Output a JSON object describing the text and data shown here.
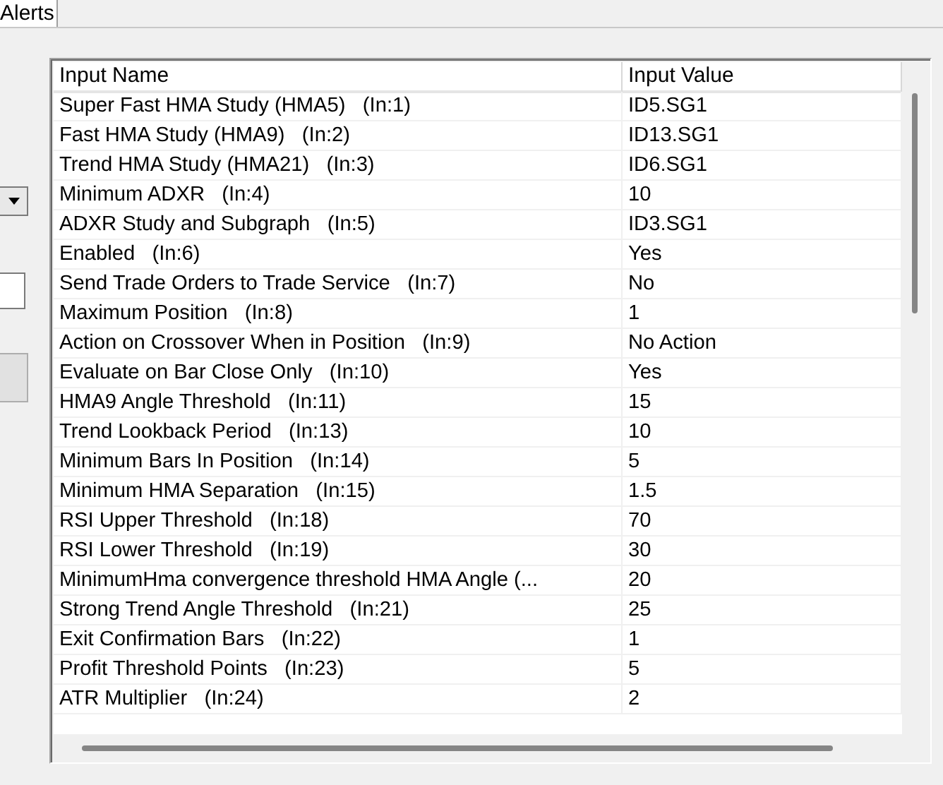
{
  "tabs": [
    {
      "label": "Alerts",
      "selected": true
    }
  ],
  "table": {
    "columns": [
      "Input Name",
      "Input Value"
    ],
    "rows": [
      {
        "name": "Super Fast HMA Study (HMA5)   (In:1)",
        "value": "ID5.SG1"
      },
      {
        "name": "Fast HMA Study (HMA9)   (In:2)",
        "value": "ID13.SG1"
      },
      {
        "name": "Trend HMA Study (HMA21)   (In:3)",
        "value": "ID6.SG1"
      },
      {
        "name": "Minimum ADXR   (In:4)",
        "value": "10"
      },
      {
        "name": "ADXR Study and Subgraph   (In:5)",
        "value": "ID3.SG1"
      },
      {
        "name": "Enabled   (In:6)",
        "value": "Yes"
      },
      {
        "name": "Send Trade Orders to Trade Service   (In:7)",
        "value": "No"
      },
      {
        "name": "Maximum Position   (In:8)",
        "value": "1"
      },
      {
        "name": "Action on Crossover When in Position   (In:9)",
        "value": "No Action"
      },
      {
        "name": "Evaluate on Bar Close Only   (In:10)",
        "value": "Yes"
      },
      {
        "name": "HMA9 Angle Threshold   (In:11)",
        "value": "15"
      },
      {
        "name": "Trend Lookback Period   (In:13)",
        "value": "10"
      },
      {
        "name": "Minimum Bars In Position   (In:14)",
        "value": "5"
      },
      {
        "name": "Minimum HMA Separation   (In:15)",
        "value": "1.5"
      },
      {
        "name": "RSI Upper Threshold   (In:18)",
        "value": "70"
      },
      {
        "name": "RSI Lower Threshold   (In:19)",
        "value": "30"
      },
      {
        "name": "MinimumHma convergence threshold HMA Angle (...",
        "value": "20"
      },
      {
        "name": "Strong Trend Angle Threshold   (In:21)",
        "value": "25"
      },
      {
        "name": "Exit Confirmation Bars   (In:22)",
        "value": "1"
      },
      {
        "name": "Profit Threshold Points   (In:23)",
        "value": "5"
      },
      {
        "name": "ATR Multiplier   (In:24)",
        "value": "2"
      }
    ]
  }
}
